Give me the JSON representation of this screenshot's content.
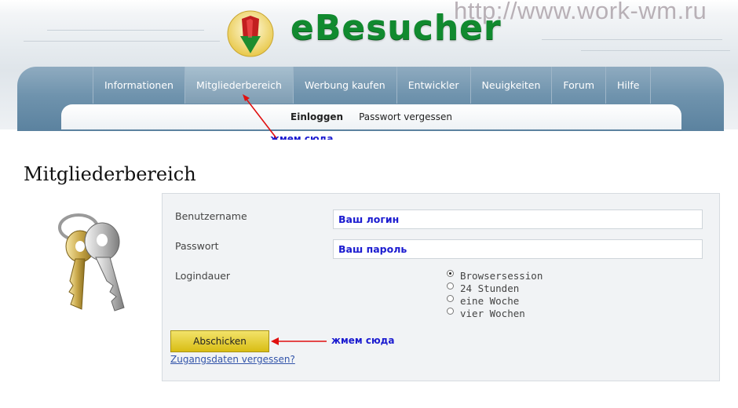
{
  "watermark": "http://www.work-wm.ru",
  "brand": {
    "name": "eBesucher",
    "accent": "#118a2f"
  },
  "nav": {
    "items": [
      {
        "label": "Informationen"
      },
      {
        "label": "Mitgliederbereich",
        "active": true
      },
      {
        "label": "Werbung kaufen"
      },
      {
        "label": "Entwickler"
      },
      {
        "label": "Neuigkeiten"
      },
      {
        "label": "Forum"
      },
      {
        "label": "Hilfe"
      }
    ]
  },
  "subnav": {
    "login": "Einloggen",
    "forgot_password": "Passwort vergessen"
  },
  "page": {
    "title": "Mitgliederbereich"
  },
  "form": {
    "username_label": "Benutzername",
    "username_value": "Ваш логин",
    "password_label": "Passwort",
    "password_value": "Ваш пароль",
    "duration_label": "Logindauer",
    "duration_options": [
      {
        "label": "Browsersession",
        "checked": true
      },
      {
        "label": "24 Stunden",
        "checked": false
      },
      {
        "label": "eine Woche",
        "checked": false
      },
      {
        "label": "vier Wochen",
        "checked": false
      }
    ],
    "submit_label": "Abschicken",
    "forgot_link": "Zugangsdaten vergessen?"
  },
  "annotations": {
    "nav_hint": "жмем сюда",
    "submit_hint": "жмем сюда",
    "color": "#1b1bd0"
  }
}
